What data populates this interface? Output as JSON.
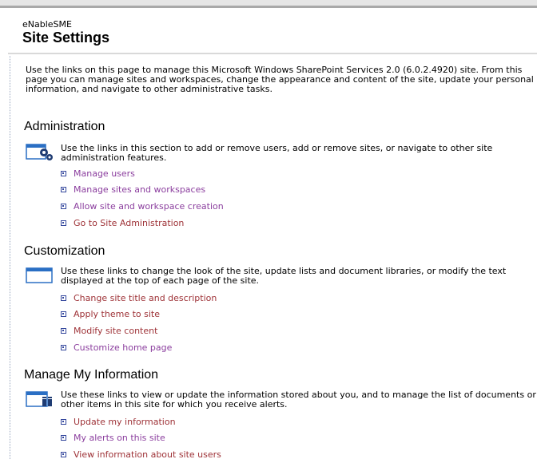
{
  "header": {
    "site_name": "eNableSME",
    "page_title": "Site Settings"
  },
  "intro": "Use the links on this page to manage this Microsoft Windows SharePoint Services 2.0 (6.0.2.4920) site. From this page you can manage sites and workspaces, change the appearance and content of the site, update your personal information, and navigate to other administrative tasks.",
  "sections": [
    {
      "title": "Administration",
      "icon": "gears-icon",
      "description": "Use the links in this section to add or remove users, add or remove sites, or navigate to other site administration features.",
      "links": [
        {
          "label": "Manage users",
          "visited": true
        },
        {
          "label": "Manage sites and workspaces",
          "visited": true
        },
        {
          "label": "Allow site and workspace creation",
          "visited": true
        },
        {
          "label": "Go to Site Administration",
          "visited": false
        }
      ]
    },
    {
      "title": "Customization",
      "icon": "window-icon",
      "description": "Use these links to change the look of the site, update lists and document libraries, or modify the text displayed at the top of each page of the site.",
      "links": [
        {
          "label": "Change site title and description",
          "visited": false
        },
        {
          "label": "Apply theme to site",
          "visited": false
        },
        {
          "label": "Modify site content",
          "visited": false
        },
        {
          "label": "Customize home page",
          "visited": true
        }
      ]
    },
    {
      "title": "Manage My Information",
      "icon": "user-info-icon",
      "description": "Use these links to view or update the information stored about you, and to manage the list of documents or other items in this site for which you receive alerts.",
      "links": [
        {
          "label": "Update my information",
          "visited": false
        },
        {
          "label": "My alerts on this site",
          "visited": true
        },
        {
          "label": "View information about site users",
          "visited": false
        }
      ]
    }
  ],
  "colors": {
    "link_visited": "#8b3e9e",
    "link_unvisited": "#9e3237",
    "bullet": "#33469c",
    "icon_blue": "#2a6fc4"
  }
}
